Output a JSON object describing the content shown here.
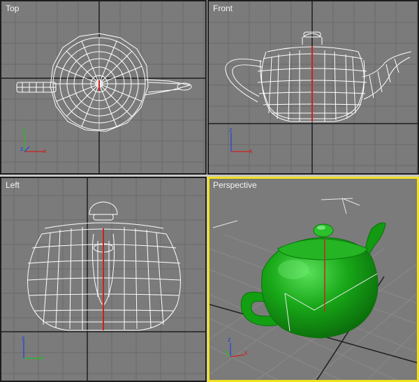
{
  "viewports": {
    "top": {
      "label": "Top"
    },
    "front": {
      "label": "Front"
    },
    "left": {
      "label": "Left"
    },
    "perspective": {
      "label": "Perspective"
    }
  },
  "axis_letters": {
    "x": "x",
    "y": "y",
    "z": "z"
  },
  "colors": {
    "viewport_bg": "#7b7b7b",
    "grid": "#6a6a6a",
    "home_grid": "#1e1e1e",
    "wireframe": "#ffffff",
    "active_border": "#f0e020",
    "teapot_green": "#18a818",
    "axis_x": "#d02020",
    "axis_y": "#20c020",
    "axis_z": "#2040e0"
  },
  "icons": [
    "teapot-wireframe-top",
    "teapot-wireframe-front",
    "teapot-wireframe-left",
    "teapot-shaded-perspective",
    "axis-tripod-icon",
    "pivot-gizmo-icon"
  ]
}
